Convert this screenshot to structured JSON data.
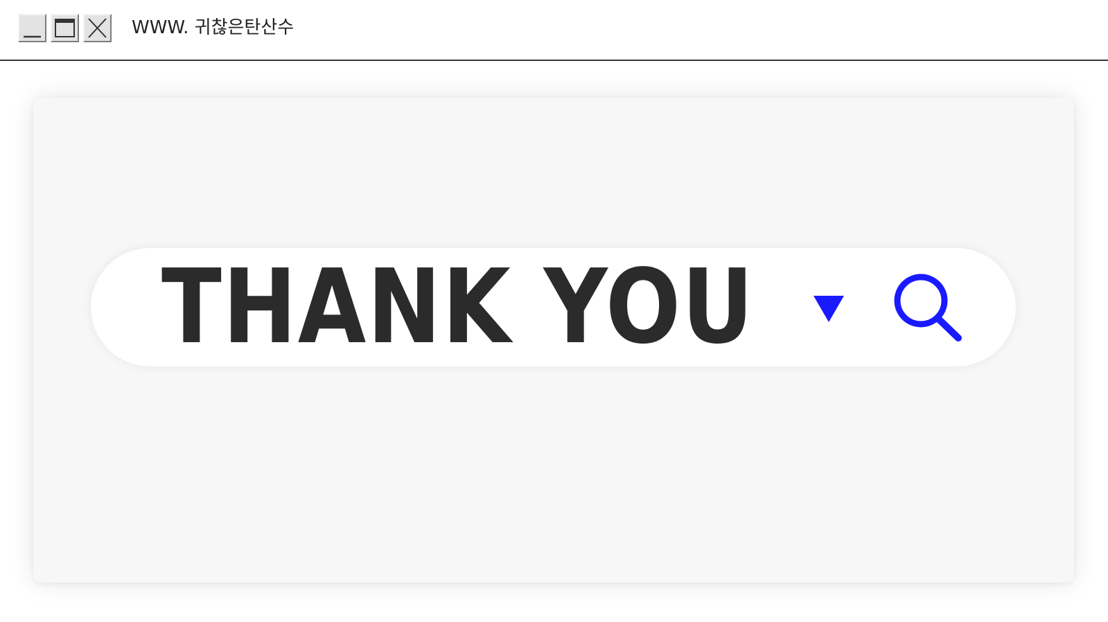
{
  "window": {
    "title": "WWW. 귀찮은탄산수",
    "controls": [
      "minimize",
      "maximize",
      "close"
    ]
  },
  "search": {
    "value": "THANK YOU",
    "dropdown_icon": "triangle-down-icon",
    "search_icon": "magnifier-icon"
  },
  "colors": {
    "accent": "#1a1aff",
    "text": "#2b2b2b",
    "card_bg": "#f7f7f7"
  }
}
